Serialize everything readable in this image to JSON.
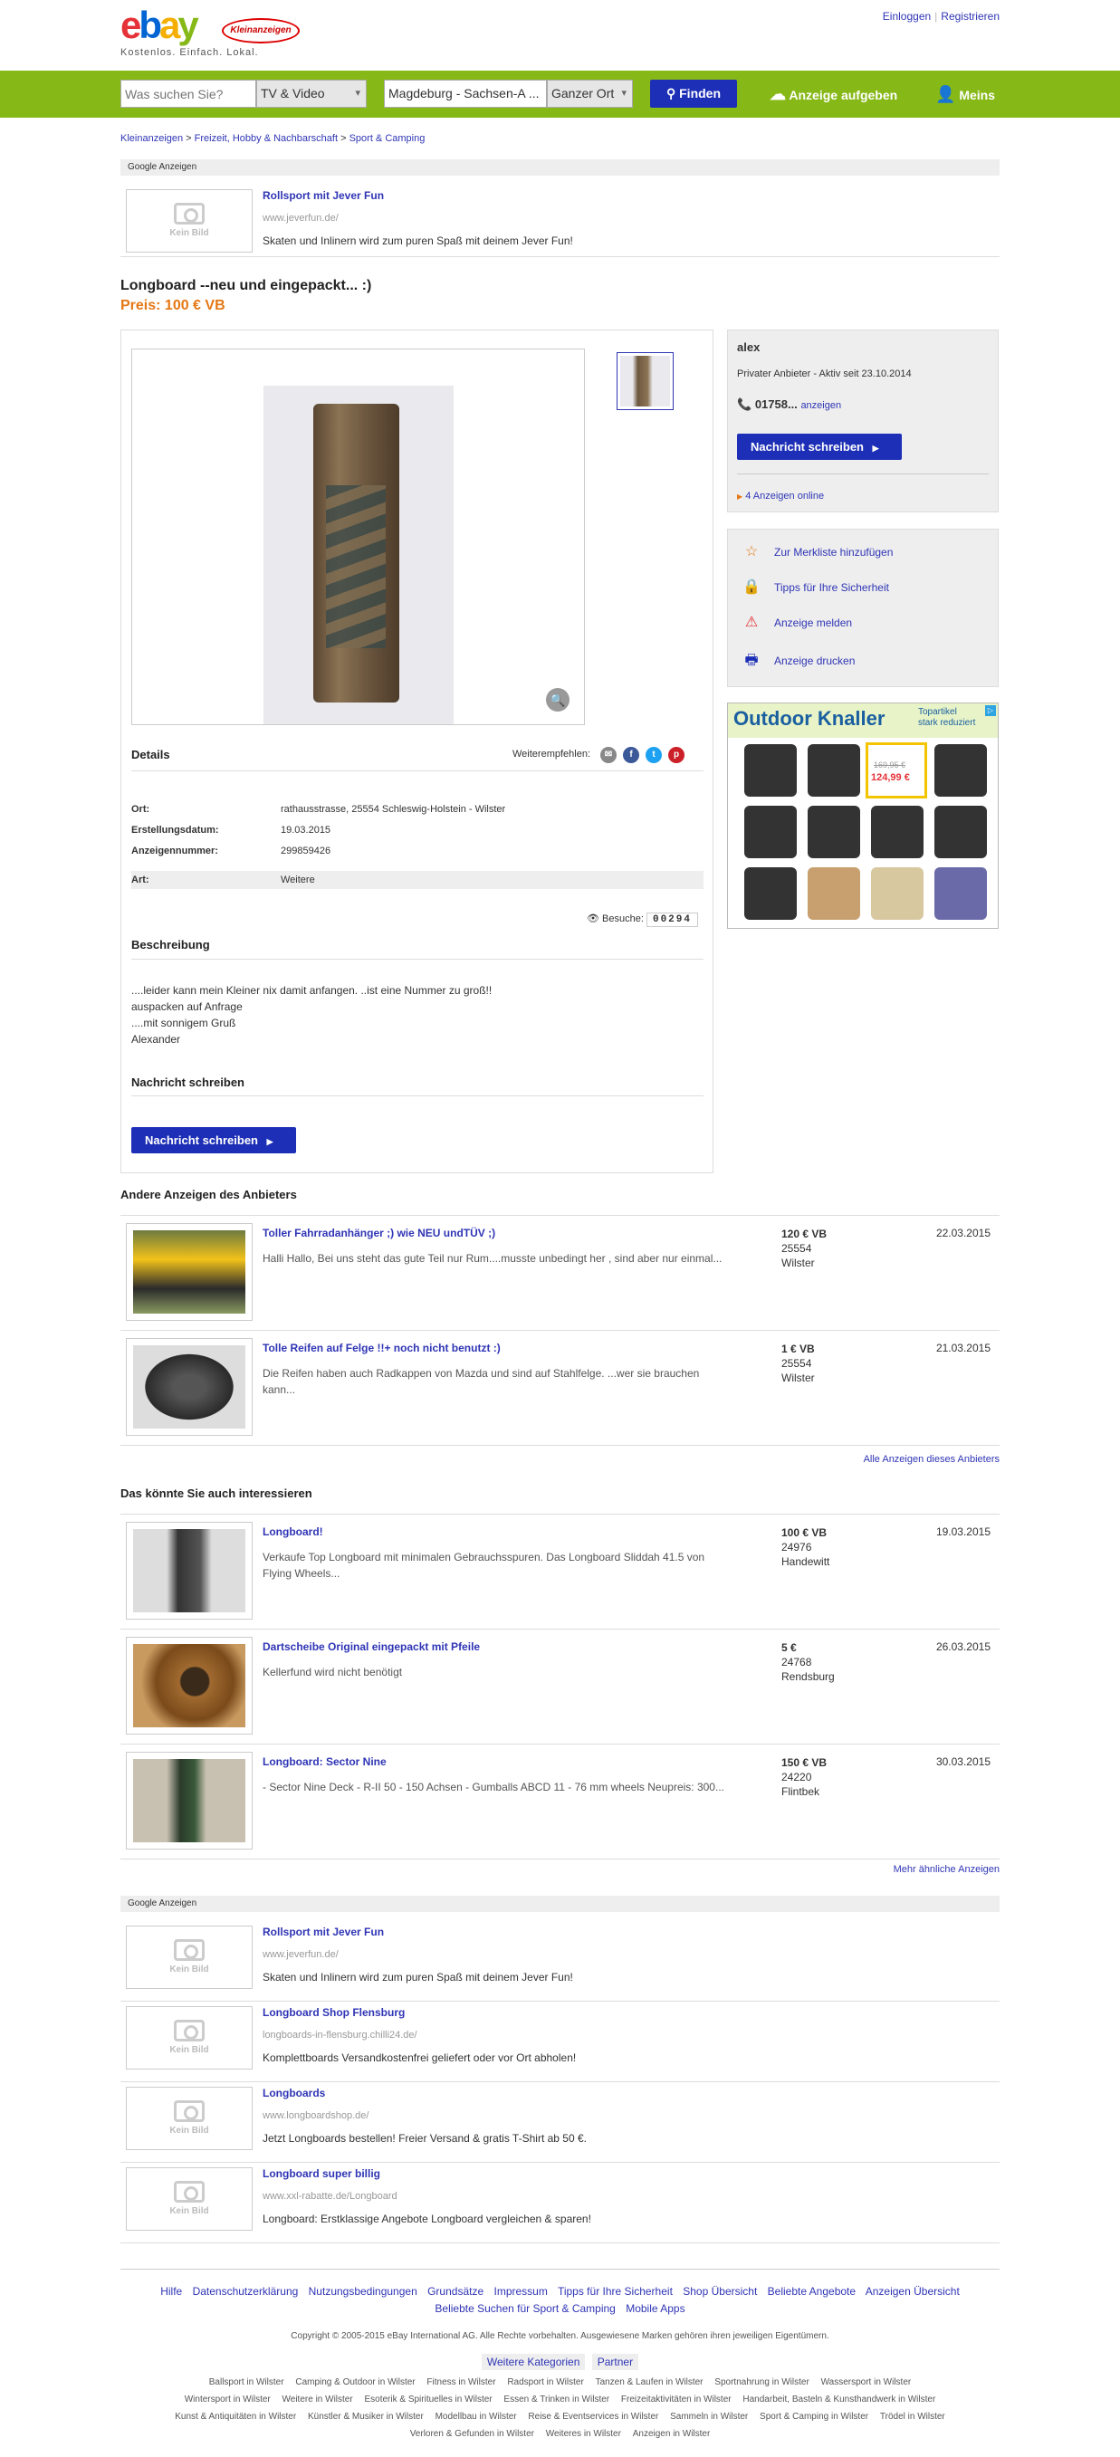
{
  "header": {
    "logo_text": "ebay",
    "logo_badge": "Kleinanzeigen",
    "slogan": "Kostenlos. Einfach. Lokal.",
    "login": "Einloggen",
    "register": "Registrieren"
  },
  "search": {
    "placeholder": "Was suchen Sie?",
    "category": "TV & Video",
    "location": "Magdeburg - Sachsen-A ...",
    "radius": "Ganzer Ort",
    "find": "Finden",
    "post_ad": "Anzeige aufgeben",
    "meins": "Meins"
  },
  "breadcrumb": {
    "items": [
      "Kleinanzeigen",
      "Freizeit, Hobby & Nachbarschaft",
      "Sport & Camping"
    ]
  },
  "google_ads_label": "Google Anzeigen",
  "top_ad": {
    "no_image": "Kein Bild",
    "title": "Rollsport mit Jever Fun",
    "url": "www.jeverfun.de/",
    "desc": "Skaten und Inlinern wird zum puren Spaß mit deinem Jever Fun!"
  },
  "listing": {
    "title": "Longboard --neu und eingepackt... :)",
    "price": "Preis: 100 € VB",
    "details_heading": "Details",
    "share_label": "Weiterempfehlen:",
    "details": [
      {
        "label": "Ort:",
        "value": "rathausstrasse, 25554 Schleswig-Holstein - Wilster"
      },
      {
        "label": "Erstellungsdatum:",
        "value": "19.03.2015"
      },
      {
        "label": "Anzeigennummer:",
        "value": "299859426"
      }
    ],
    "art_label": "Art:",
    "art_value": "Weitere",
    "visits_label": "Besuche:",
    "visits": "00294",
    "description_heading": "Beschreibung",
    "description": [
      "....leider kann mein Kleiner nix damit anfangen. ..ist eine Nummer zu groß!!",
      "auspacken auf Anfrage",
      "....mit sonnigem Gruß",
      "Alexander"
    ],
    "message_heading": "Nachricht schreiben",
    "message_button": "Nachricht schreiben"
  },
  "seller": {
    "name": "alex",
    "type": "Privater Anbieter - Aktiv seit 23.10.2014",
    "phone": "01758...",
    "phone_link": "anzeigen",
    "message_button": "Nachricht schreiben",
    "ads_online": "4 Anzeigen online"
  },
  "actions": [
    {
      "icon": "star-icon",
      "label": "Zur Merkliste hinzufügen"
    },
    {
      "icon": "lock-icon",
      "label": "Tipps für Ihre Sicherheit"
    },
    {
      "icon": "warning-icon",
      "label": "Anzeige melden"
    },
    {
      "icon": "printer-icon",
      "label": "Anzeige drucken"
    }
  ],
  "banner": {
    "title": "Outdoor Knaller",
    "subtitle1": "Topartikel",
    "subtitle2": "stark reduziert",
    "old_price": "169,95 €",
    "new_price": "124,99 €"
  },
  "other_ads": {
    "heading": "Andere Anzeigen des Anbieters",
    "items": [
      {
        "title": "Toller Fahrradanhänger ;) wie NEU undTÜV ;)",
        "desc": "Halli Hallo, Bei uns steht das gute Teil nur Rum....musste unbedingt her , sind aber nur einmal...",
        "price": "120 € VB",
        "zip": "25554",
        "city": "Wilster",
        "date": "22.03.2015"
      },
      {
        "title": "Tolle Reifen auf Felge !!+ noch nicht benutzt :)",
        "desc": "Die Reifen haben auch Radkappen von Mazda und sind auf Stahlfelge. ...wer sie brauchen kann...",
        "price": "1 € VB",
        "zip": "25554",
        "city": "Wilster",
        "date": "21.03.2015"
      }
    ],
    "all_link": "Alle Anzeigen dieses Anbieters"
  },
  "similar": {
    "heading": "Das könnte Sie auch interessieren",
    "items": [
      {
        "title": "Longboard!",
        "desc": "Verkaufe Top Longboard mit minimalen Gebrauchsspuren. Das Longboard Sliddah 41.5 von Flying Wheels...",
        "price": "100 € VB",
        "zip": "24976",
        "city": "Handewitt",
        "date": "19.03.2015"
      },
      {
        "title": "Dartscheibe Original eingepackt mit Pfeile",
        "desc": "Kellerfund wird nicht benötigt",
        "price": "5 €",
        "zip": "24768",
        "city": "Rendsburg",
        "date": "26.03.2015"
      },
      {
        "title": "Longboard: Sector Nine",
        "desc": "- Sector Nine Deck - R-II 50 - 150 Achsen - Gumballs ABCD 11 - 76 mm wheels Neupreis: 300...",
        "price": "150 € VB",
        "zip": "24220",
        "city": "Flintbek",
        "date": "30.03.2015"
      }
    ],
    "more_link": "Mehr ähnliche Anzeigen"
  },
  "bottom_ads": [
    {
      "title": "Rollsport mit Jever Fun",
      "url": "www.jeverfun.de/",
      "desc": "Skaten und Inlinern wird zum puren Spaß mit deinem Jever Fun!"
    },
    {
      "title": "Longboard Shop Flensburg",
      "url": "longboards-in-flensburg.chilli24.de/",
      "desc": "Komplettboards Versandkostenfrei geliefert oder vor Ort abholen!"
    },
    {
      "title": "Longboards",
      "url": "www.longboardshop.de/",
      "desc": "Jetzt Longboards bestellen! Freier Versand & gratis T-Shirt ab 50 €."
    },
    {
      "title": "Longboard super billig",
      "url": "www.xxl-rabatte.de/Longboard",
      "desc": "Longboard: Erstklassige Angebote Longboard vergleichen & sparen!"
    }
  ],
  "footer": {
    "links1": [
      "Hilfe",
      "Datenschutzerklärung",
      "Nutzungsbedingungen",
      "Grundsätze",
      "Impressum",
      "Tipps für Ihre Sicherheit",
      "Shop Übersicht",
      "Beliebte Angebote",
      "Anzeigen Übersicht"
    ],
    "links2": [
      "Beliebte Suchen für Sport & Camping",
      "Mobile Apps"
    ],
    "copyright": "Copyright © 2005-2015 eBay International AG. Alle Rechte vorbehalten. Ausgewiesene Marken gehören ihren jeweiligen Eigentümern.",
    "tabs": [
      "Weitere Kategorien",
      "Partner"
    ],
    "cat_links": [
      "Ballsport in Wilster",
      "Camping & Outdoor in Wilster",
      "Fitness in Wilster",
      "Radsport in Wilster",
      "Tanzen & Laufen in Wilster",
      "Sportnahrung in Wilster",
      "Wassersport in Wilster",
      "Wintersport in Wilster",
      "Weitere in Wilster",
      "Esoterik & Spirituelles in Wilster",
      "Essen & Trinken in Wilster",
      "Freizeitaktivitäten in Wilster",
      "Handarbeit, Basteln & Kunsthandwerk in Wilster",
      "Kunst & Antiquitäten in Wilster",
      "Künstler & Musiker in Wilster",
      "Modellbau in Wilster",
      "Reise & Eventservices in Wilster",
      "Sammeln in Wilster",
      "Sport & Camping in Wilster",
      "Trödel in Wilster",
      "Verloren & Gefunden in Wilster",
      "Weiteres in Wilster",
      "Anzeigen in Wilster"
    ]
  }
}
